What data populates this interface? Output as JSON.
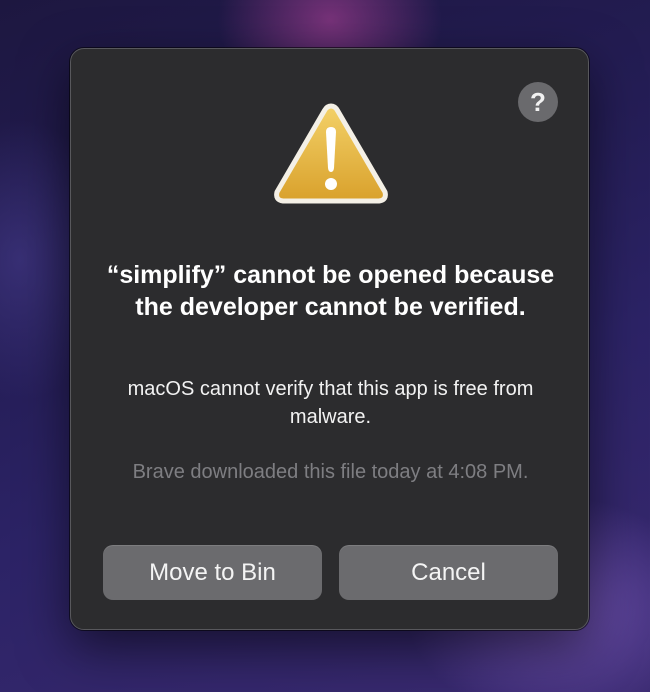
{
  "dialog": {
    "title": "“simplify” cannot be opened because the developer cannot be verified.",
    "message": "macOS cannot verify that this app is free from malware.",
    "download_info": "Brave downloaded this file today at 4:08 PM.",
    "help_label": "?",
    "icon": "warning-icon",
    "buttons": {
      "move_to_bin": "Move to Bin",
      "cancel": "Cancel"
    }
  },
  "colors": {
    "dialog_background": "#2c2c2e",
    "button_background": "#6b6b6e",
    "warning_yellow": "#e8b93c",
    "secondary_text": "#7e7e82"
  }
}
